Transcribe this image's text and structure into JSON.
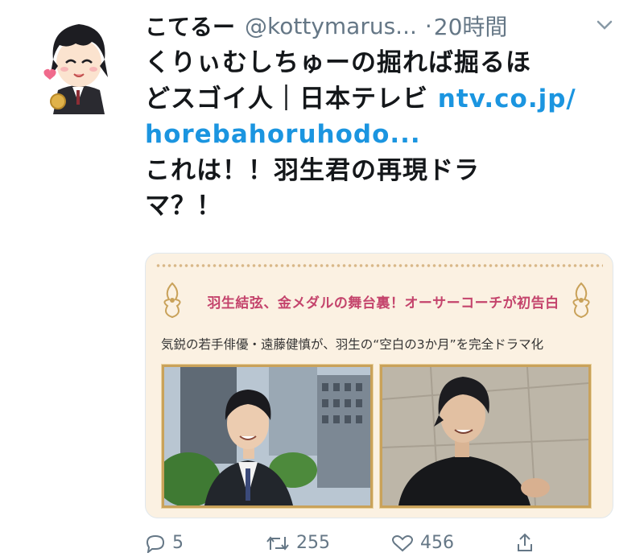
{
  "tweet": {
    "display_name": "こてるー",
    "handle": "@kottymarus...",
    "separator": "·",
    "time": "20時間",
    "text_line1": "くりぃむしちゅーの掘れば掘るほ",
    "text_line2_plain": "どスゴイ人｜日本テレビ ",
    "text_line2_link": "ntv.co.jp/",
    "text_line3_link": "horebahoruhodo...",
    "text_line4": "これは！！羽生君の再現ドラ",
    "text_line5": "マ？！"
  },
  "card": {
    "title": "羽生結弦、金メダルの舞台裏！オーサーコーチが初告白",
    "subtitle": "気鋭の若手俳優・遠藤健慎が、羽生の“空白の3か月”を完全ドラマ化",
    "accent_color": "#c4446c",
    "frame_color": "#c9a25a"
  },
  "actions": {
    "reply_count": "5",
    "retweet_count": "255",
    "like_count": "456",
    "icons": [
      "reply-icon",
      "retweet-icon",
      "like-icon",
      "share-icon"
    ]
  },
  "colors": {
    "link": "#1b95e0",
    "muted": "#657786",
    "text": "#14171a"
  }
}
